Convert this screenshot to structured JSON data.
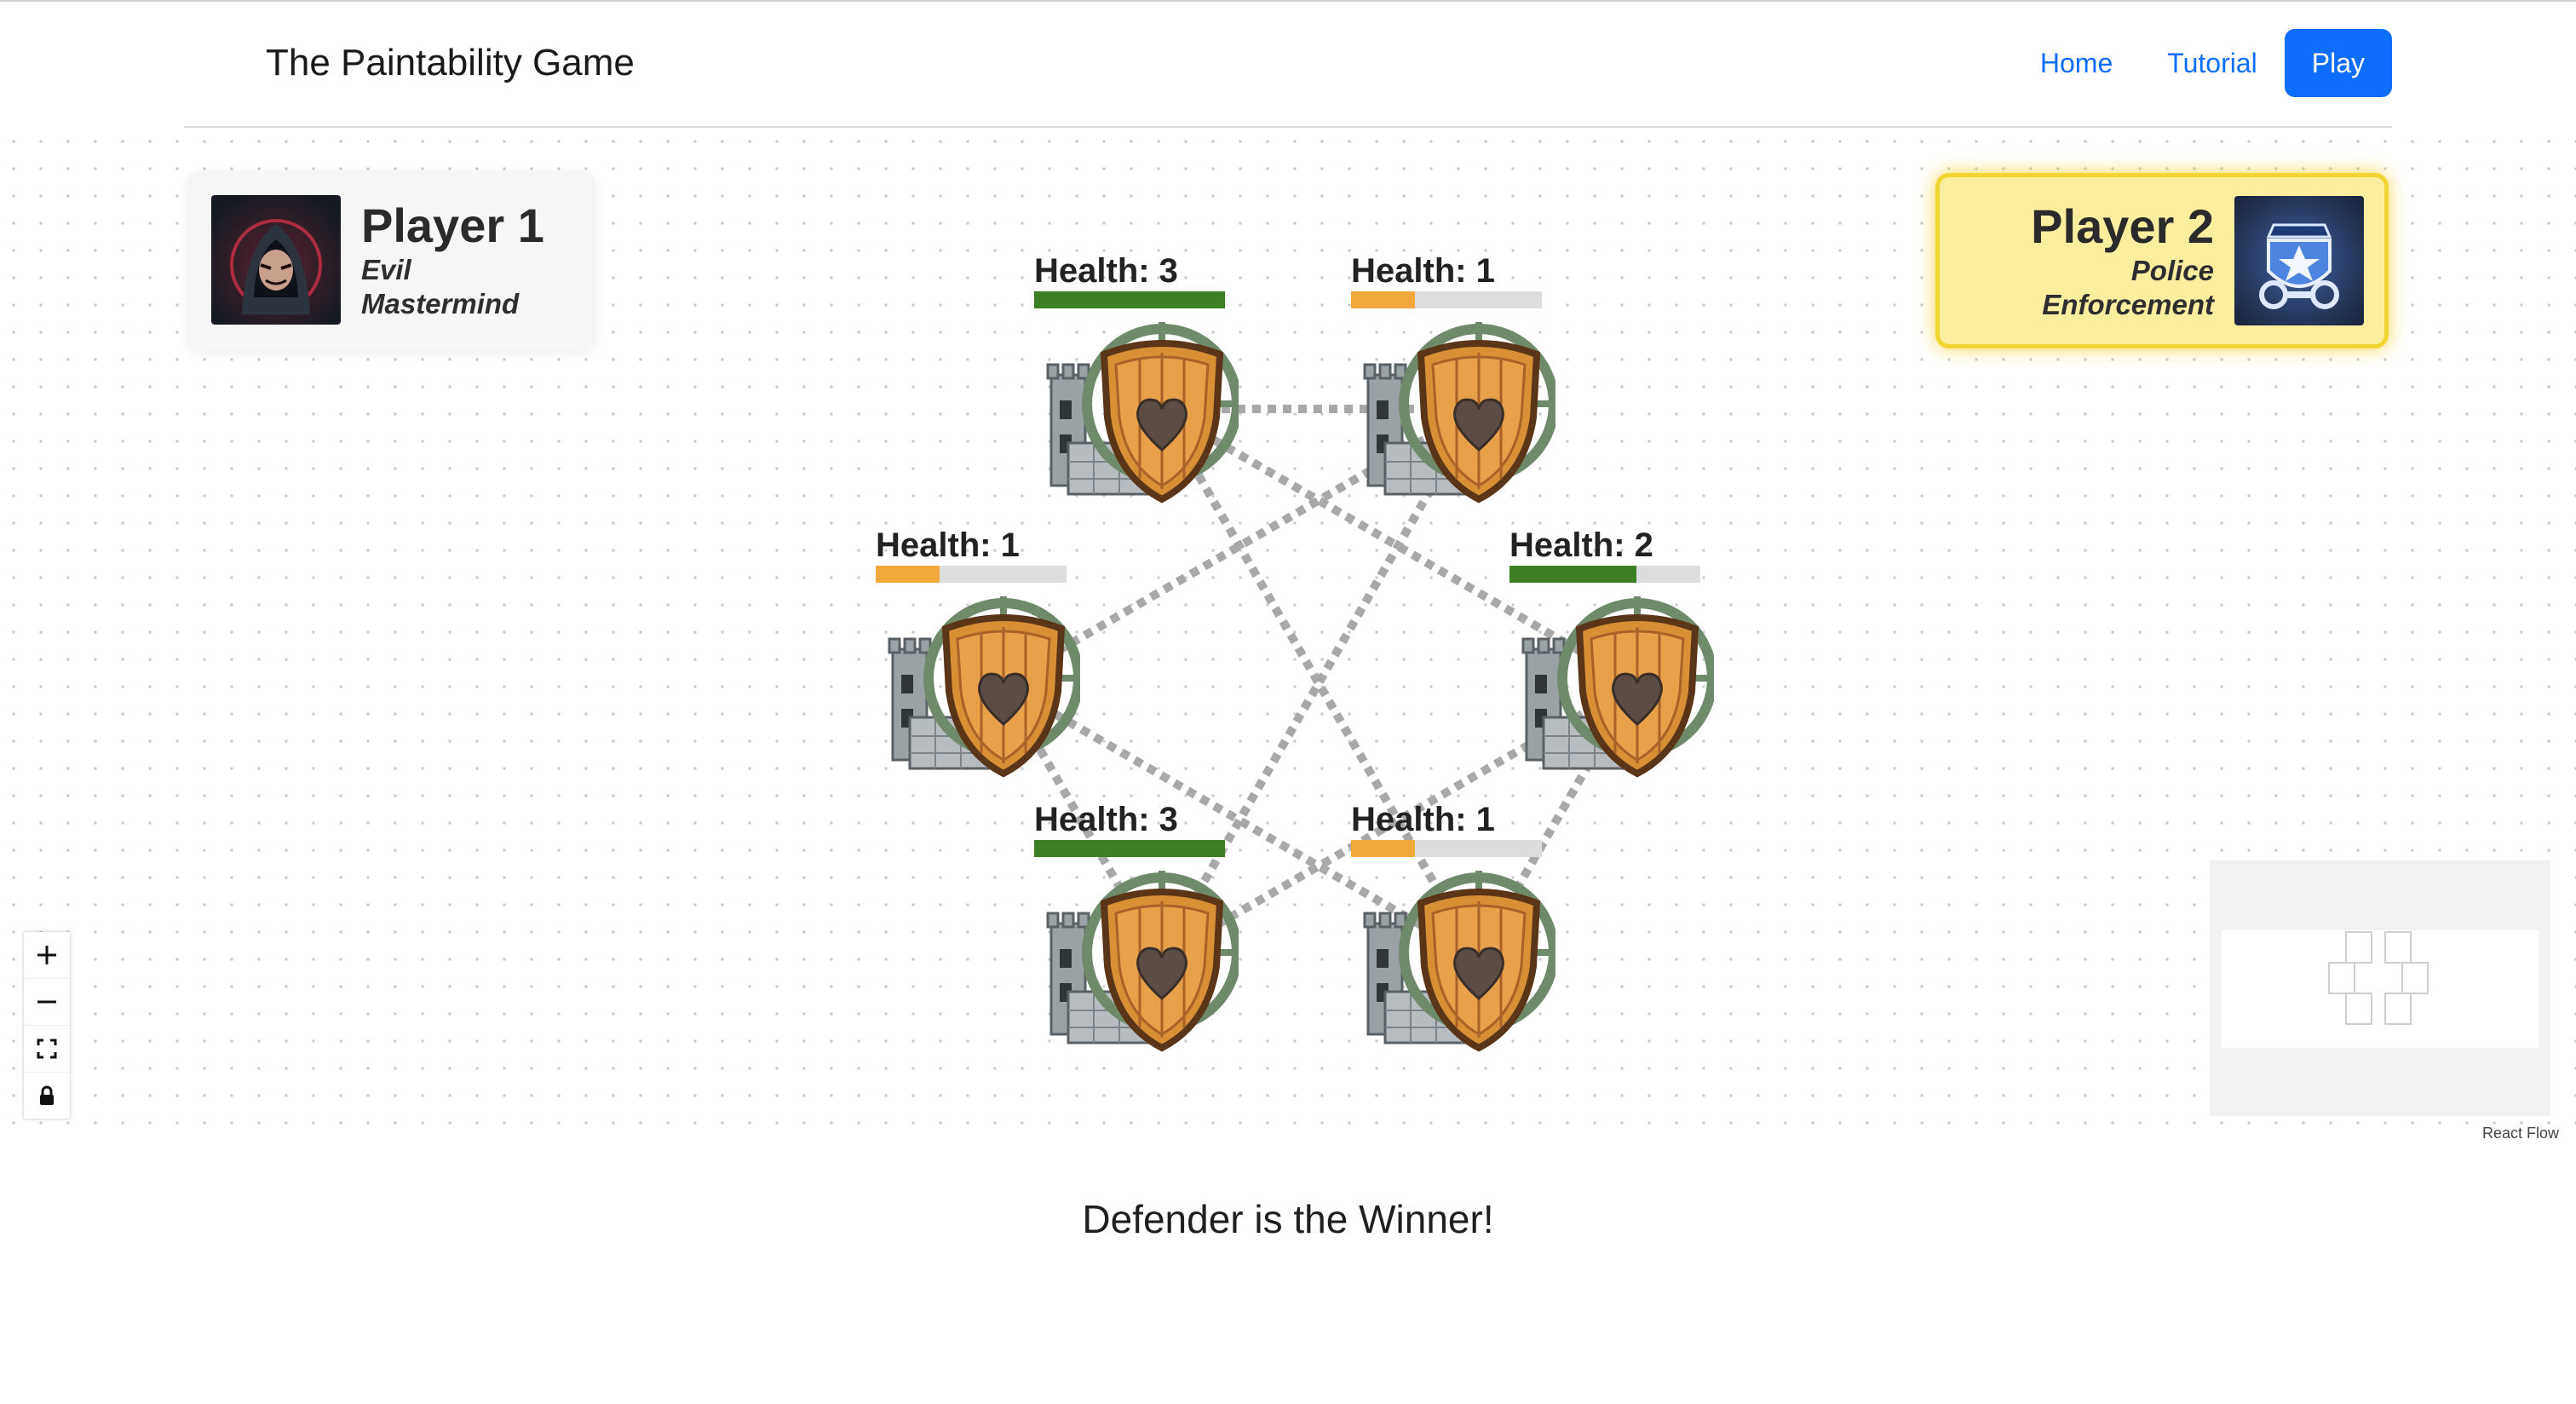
{
  "app": {
    "title": "The Paintability Game"
  },
  "nav": {
    "home": "Home",
    "tutorial": "Tutorial",
    "play": "Play"
  },
  "players": {
    "p1": {
      "name": "Player 1",
      "role": "Evil Mastermind",
      "avatar_icon": "hooded-villain-icon"
    },
    "p2": {
      "name": "Player 2",
      "role": "Police Enforcement",
      "avatar_icon": "police-badge-icon",
      "active": true
    }
  },
  "nodes": [
    {
      "label": "Health: 3",
      "health": 3,
      "max": 3
    },
    {
      "label": "Health: 1",
      "health": 1,
      "max": 3
    },
    {
      "label": "Health: 1",
      "health": 1,
      "max": 3
    },
    {
      "label": "Health: 2",
      "health": 2,
      "max": 3
    },
    {
      "label": "Health: 3",
      "health": 3,
      "max": 3
    },
    {
      "label": "Health: 1",
      "health": 1,
      "max": 3
    }
  ],
  "edges": [
    [
      0,
      1
    ],
    [
      0,
      3
    ],
    [
      0,
      5
    ],
    [
      1,
      2
    ],
    [
      1,
      4
    ],
    [
      2,
      4
    ],
    [
      2,
      5
    ],
    [
      3,
      4
    ],
    [
      3,
      5
    ]
  ],
  "colors": {
    "health_high": "#3d7f25",
    "health_low": "#f0a93a",
    "health_empty": "#dddddd",
    "edge": "#a8a8a8",
    "accent": "#0d6efd"
  },
  "controls": [
    "zoom-in",
    "zoom-out",
    "fit-view",
    "lock"
  ],
  "attribution": "React Flow",
  "status": {
    "winner": "Defender is the Winner!"
  }
}
